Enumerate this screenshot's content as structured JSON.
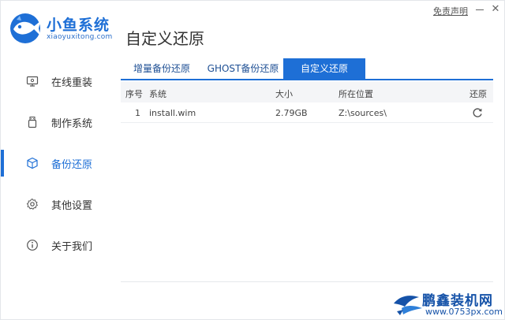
{
  "brand": {
    "name": "小鱼系统",
    "url": "xiaoyuxitong.com",
    "color": "#1e6fd6"
  },
  "header": {
    "page_title": "自定义还原",
    "disclaimer": "免责声明",
    "close_glyph": "✕"
  },
  "sidebar": {
    "items": [
      {
        "label": "在线重装",
        "icon": "monitor-icon"
      },
      {
        "label": "制作系统",
        "icon": "usb-drive-icon"
      },
      {
        "label": "备份还原",
        "icon": "backup-cube-icon",
        "active": true
      },
      {
        "label": "其他设置",
        "icon": "gear-icon"
      },
      {
        "label": "关于我们",
        "icon": "info-icon"
      }
    ]
  },
  "tabs": [
    {
      "label": "增量备份还原"
    },
    {
      "label": "GHOST备份还原"
    },
    {
      "label": "自定义还原",
      "active": true
    }
  ],
  "table": {
    "headers": {
      "index": "序号",
      "system": "系统",
      "size": "大小",
      "location": "所在位置",
      "restore": "还原"
    },
    "rows": [
      {
        "index": "1",
        "system": "install.wim",
        "size": "2.79GB",
        "location": "Z:\\sources\\",
        "restore_icon": "refresh-icon"
      }
    ]
  },
  "watermark": {
    "name": "鹏鑫装机网",
    "url": "www.0753px.com"
  }
}
